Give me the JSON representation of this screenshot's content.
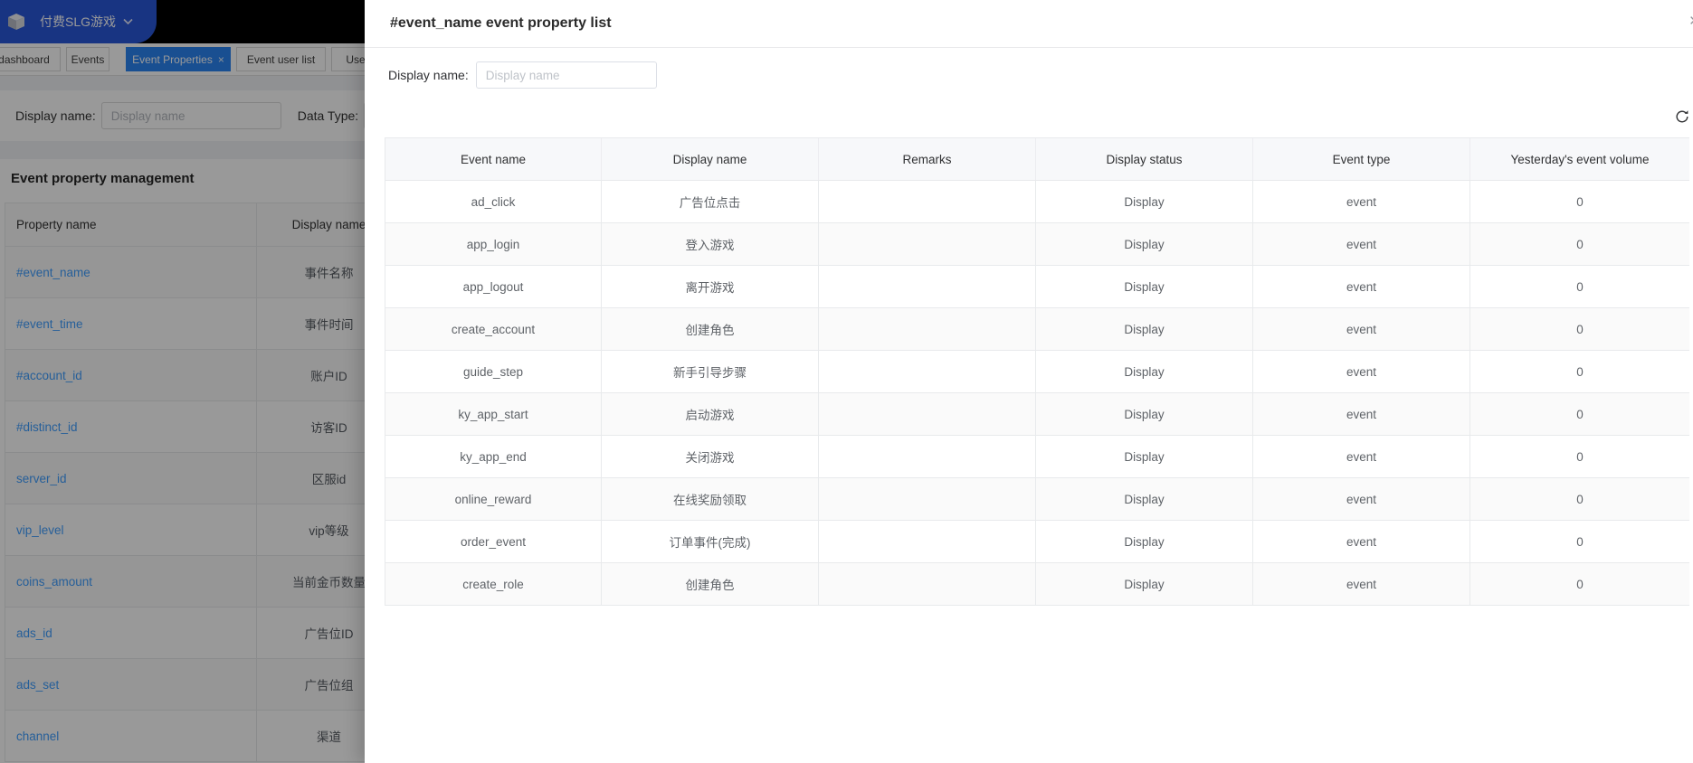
{
  "app": {
    "project_name": "付费SLG游戏",
    "logo_icon": "cube-icon",
    "chevron_icon": "chevron-down"
  },
  "tabs": [
    {
      "label": "dashboard",
      "active": false,
      "closable": false
    },
    {
      "label": "Events",
      "active": false,
      "closable": false
    },
    {
      "label": "Event Properties",
      "active": true,
      "closable": true,
      "close_glyph": "×"
    },
    {
      "label": "Event user list",
      "active": false,
      "closable": false
    },
    {
      "label": "User",
      "active": false,
      "closable": false
    }
  ],
  "filters": {
    "display_name_label": "Display name:",
    "display_name_placeholder": "Display name",
    "data_type_label": "Data Type:"
  },
  "property_panel": {
    "title": "Event property management",
    "columns": [
      "Property name",
      "Display name"
    ],
    "rows": [
      {
        "name": "#event_name",
        "display": "事件名称"
      },
      {
        "name": "#event_time",
        "display": "事件时间"
      },
      {
        "name": "#account_id",
        "display": "账户ID"
      },
      {
        "name": "#distinct_id",
        "display": "访客ID"
      },
      {
        "name": "server_id",
        "display": "区服id"
      },
      {
        "name": "vip_level",
        "display": "vip等级"
      },
      {
        "name": "coins_amount",
        "display": "当前金币数量"
      },
      {
        "name": "ads_id",
        "display": "广告位ID"
      },
      {
        "name": "ads_set",
        "display": "广告位组"
      },
      {
        "name": "channel",
        "display": "渠道"
      }
    ]
  },
  "drawer": {
    "title": "#event_name event property list",
    "close_glyph": "×",
    "display_name_label": "Display name:",
    "display_name_placeholder": "Display name",
    "refresh_icon": "refresh-icon",
    "table": {
      "columns": [
        "Event name",
        "Display name",
        "Remarks",
        "Display status",
        "Event type",
        "Yesterday's event volume"
      ],
      "rows": [
        {
          "event_name": "ad_click",
          "display_name": "广告位点击",
          "remarks": "",
          "display_status": "Display",
          "event_type": "event",
          "yesterday_volume": "0"
        },
        {
          "event_name": "app_login",
          "display_name": "登入游戏",
          "remarks": "",
          "display_status": "Display",
          "event_type": "event",
          "yesterday_volume": "0"
        },
        {
          "event_name": "app_logout",
          "display_name": "离开游戏",
          "remarks": "",
          "display_status": "Display",
          "event_type": "event",
          "yesterday_volume": "0"
        },
        {
          "event_name": "create_account",
          "display_name": "创建角色",
          "remarks": "",
          "display_status": "Display",
          "event_type": "event",
          "yesterday_volume": "0"
        },
        {
          "event_name": "guide_step",
          "display_name": "新手引导步骤",
          "remarks": "",
          "display_status": "Display",
          "event_type": "event",
          "yesterday_volume": "0"
        },
        {
          "event_name": "ky_app_start",
          "display_name": "启动游戏",
          "remarks": "",
          "display_status": "Display",
          "event_type": "event",
          "yesterday_volume": "0"
        },
        {
          "event_name": "ky_app_end",
          "display_name": "关闭游戏",
          "remarks": "",
          "display_status": "Display",
          "event_type": "event",
          "yesterday_volume": "0"
        },
        {
          "event_name": "online_reward",
          "display_name": "在线奖励领取",
          "remarks": "",
          "display_status": "Display",
          "event_type": "event",
          "yesterday_volume": "0"
        },
        {
          "event_name": "order_event",
          "display_name": "订单事件(完成)",
          "remarks": "",
          "display_status": "Display",
          "event_type": "event",
          "yesterday_volume": "0"
        },
        {
          "event_name": "create_role",
          "display_name": "创建角色",
          "remarks": "",
          "display_status": "Display",
          "event_type": "event",
          "yesterday_volume": "0"
        }
      ]
    }
  },
  "colors": {
    "primary_link": "#409eff",
    "active_tab": "#2b84f2",
    "project_button": "#2857d9",
    "topbar": "#000000",
    "mask": "rgba(0,0,0,0.40)"
  }
}
